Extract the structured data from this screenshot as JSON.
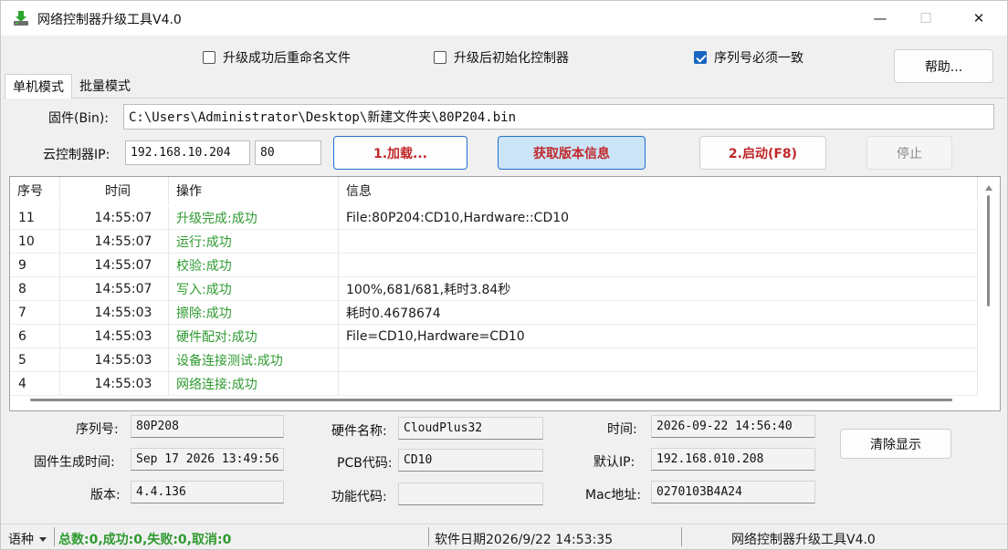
{
  "window": {
    "title": "网络控制器升级工具V4.0",
    "minimize": "—",
    "maximize": "☐",
    "close": "✕"
  },
  "options": {
    "rename_label": "升级成功后重命名文件",
    "rename_checked": false,
    "init_label": "升级后初始化控制器",
    "init_checked": false,
    "serial_label": "序列号必须一致",
    "serial_checked": true
  },
  "help_button": "帮助...",
  "tabs": [
    {
      "label": "单机模式",
      "active": true
    },
    {
      "label": "批量模式",
      "active": false
    }
  ],
  "firmware": {
    "label": "固件(Bin):",
    "path": "C:\\Users\\Administrator\\Desktop\\新建文件夹\\80P204.bin"
  },
  "controller": {
    "label": "云控制器IP:",
    "ip": "192.168.10.204",
    "port": "80"
  },
  "actions": {
    "load": "1.加载...",
    "get_version": "获取版本信息",
    "start": "2.启动(F8)",
    "stop": "停止"
  },
  "log": {
    "columns": [
      "序号",
      "时间",
      "操作",
      "信息"
    ],
    "rows": [
      {
        "no": "11",
        "time": "14:55:07",
        "op": "升级完成:成功",
        "info": "File:80P204:CD10,Hardware::CD10"
      },
      {
        "no": "10",
        "time": "14:55:07",
        "op": "运行:成功",
        "info": ""
      },
      {
        "no": "9",
        "time": "14:55:07",
        "op": "校验:成功",
        "info": ""
      },
      {
        "no": "8",
        "time": "14:55:07",
        "op": "写入:成功",
        "info": "100%,681/681,耗时3.84秒"
      },
      {
        "no": "7",
        "time": "14:55:03",
        "op": "擦除:成功",
        "info": "耗时0.4678674"
      },
      {
        "no": "6",
        "time": "14:55:03",
        "op": "硬件配对:成功",
        "info": "File=CD10,Hardware=CD10"
      },
      {
        "no": "5",
        "time": "14:55:03",
        "op": "设备连接测试:成功",
        "info": ""
      },
      {
        "no": "4",
        "time": "14:55:03",
        "op": "网络连接:成功",
        "info": ""
      }
    ]
  },
  "details": {
    "serial_label": "序列号:",
    "serial_value": "80P208",
    "build_time_label": "固件生成时间:",
    "build_time_value": "Sep 17 2026 13:49:56",
    "version_label": "版本:",
    "version_value": "4.4.136",
    "hw_name_label": "硬件名称:",
    "hw_name_value": "CloudPlus32",
    "pcb_label": "PCB代码:",
    "pcb_value": "CD10",
    "func_label": "功能代码:",
    "func_value": "",
    "time_label": "时间:",
    "time_value": "2026-09-22 14:56:40",
    "default_ip_label": "默认IP:",
    "default_ip_value": "192.168.010.208",
    "mac_label": "Mac地址:",
    "mac_value": "0270103B4A24"
  },
  "clear_button": "清除显示",
  "status": {
    "language": "语种",
    "summary": "总数:0,成功:0,失败:0,取消:0",
    "software_date": "软件日期2026/9/22 14:53:35",
    "app_name": "网络控制器升级工具V4.0"
  },
  "colors": {
    "success_green": "#2e9a30",
    "accent_blue": "#1e6fd0",
    "action_red": "#c0282a"
  }
}
